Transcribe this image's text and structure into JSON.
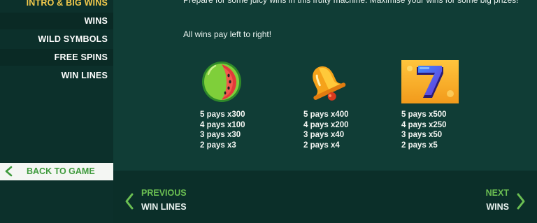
{
  "sidebar": {
    "items": [
      {
        "label": "INTRO & BIG WINS"
      },
      {
        "label": "WINS"
      },
      {
        "label": "WILD SYMBOLS"
      },
      {
        "label": "FREE SPINS"
      },
      {
        "label": "WIN LINES"
      }
    ],
    "back_label": "BACK TO GAME"
  },
  "main": {
    "intro_text": "Prepare for some juicy wins in this fruity machine. Maximise your wins for some big prizes!",
    "rule_text": "All wins pay left to right!",
    "symbols": [
      {
        "icon": "watermelon-icon",
        "pays": [
          "5 pays x300",
          "4 pays x100",
          "3 pays x30",
          "2 pays x3"
        ]
      },
      {
        "icon": "bell-icon",
        "pays": [
          "5 pays x400",
          "4 pays x200",
          "3 pays x40",
          "2 pays x4"
        ]
      },
      {
        "icon": "lucky-seven-icon",
        "pays": [
          "5 pays x500",
          "4 pays x250",
          "3 pays x50",
          "2 pays x5"
        ]
      }
    ]
  },
  "footer": {
    "prev_dir": "PREVIOUS",
    "prev_dest": "WIN LINES",
    "next_dir": "NEXT",
    "next_dest": "WINS"
  },
  "colors": {
    "accent_green": "#6bbf52",
    "active_yellow": "#f2c94c",
    "background": "#0f3a33"
  }
}
